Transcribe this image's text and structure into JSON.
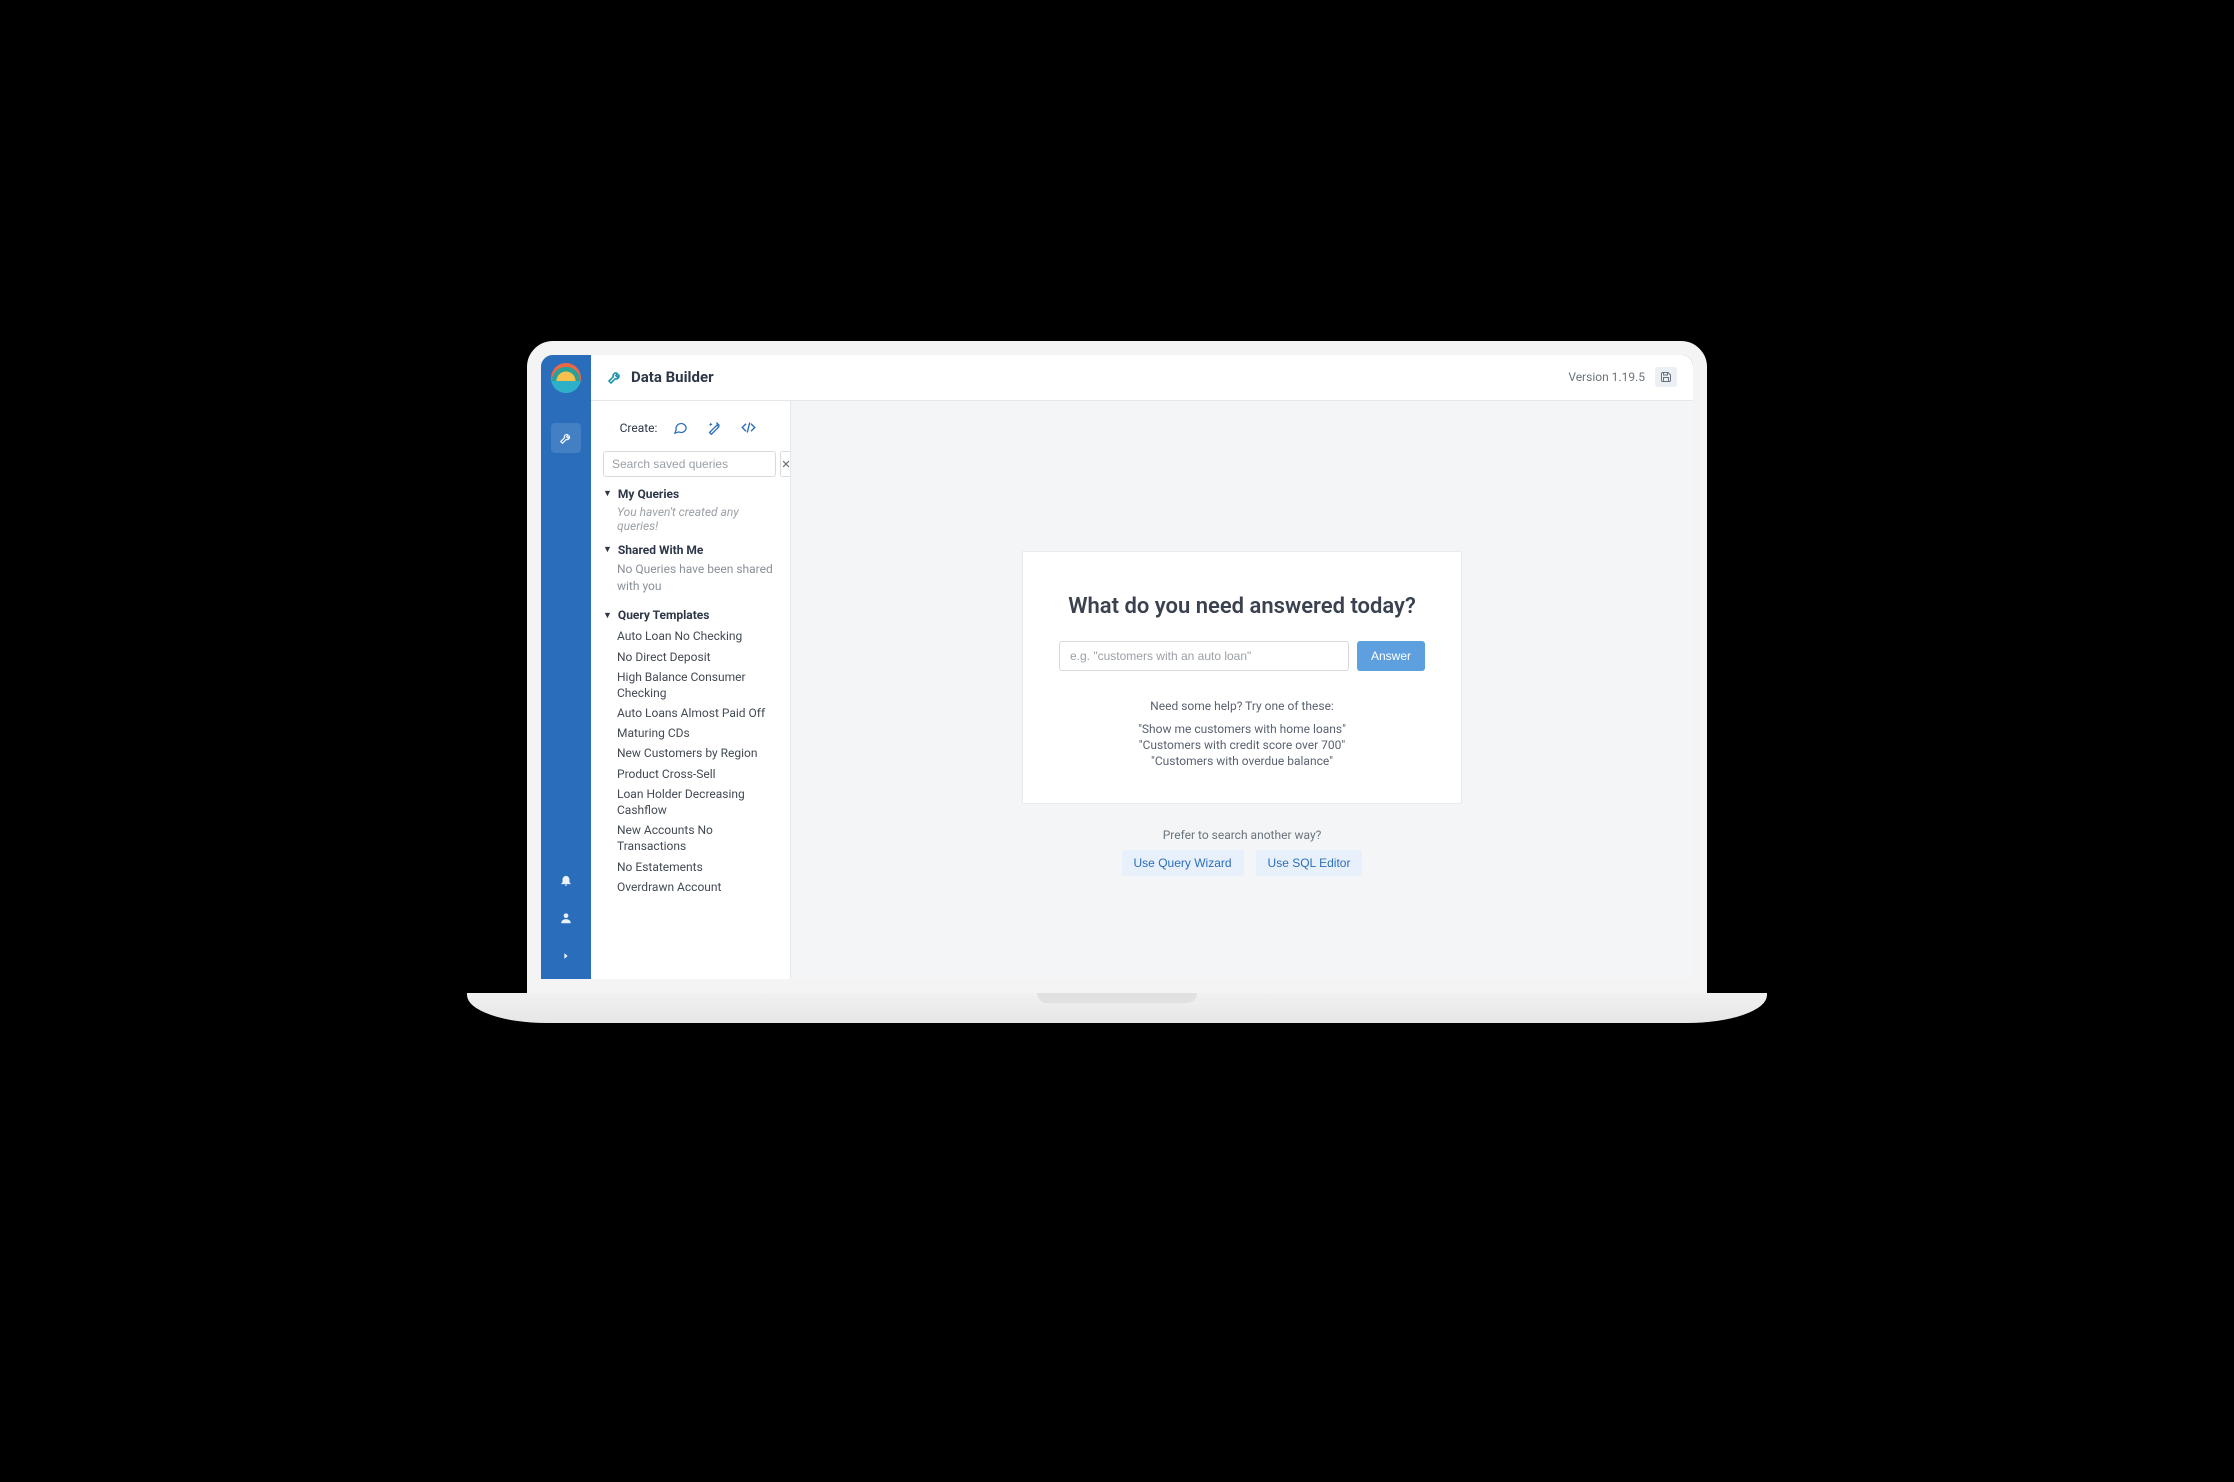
{
  "rail": {
    "icons": {
      "wrench": "wrench",
      "bell": "bell",
      "user": "user",
      "expand": "chevron-right"
    }
  },
  "header": {
    "title": "Data Builder",
    "version_label": "Version 1.19.5"
  },
  "sidepanel": {
    "create_label": "Create:",
    "search_placeholder": "Search saved queries",
    "sections": {
      "my_queries": {
        "title": "My Queries",
        "empty": "You haven't created any queries!"
      },
      "shared": {
        "title": "Shared With Me",
        "empty": "No Queries have been shared with you"
      },
      "templates": {
        "title": "Query Templates",
        "items": [
          "Auto Loan No Checking",
          "No Direct Deposit",
          "High Balance Consumer Checking",
          "Auto Loans Almost Paid Off",
          "Maturing CDs",
          "New Customers by Region",
          "Product Cross-Sell",
          "Loan Holder Decreasing Cashflow",
          "New Accounts No Transactions",
          "No Estatements",
          "Overdrawn Account"
        ]
      }
    }
  },
  "main": {
    "heading": "What do you need answered today?",
    "input_placeholder": "e.g. \"customers with an auto loan\"",
    "answer_label": "Answer",
    "help_head": "Need some help? Try one of these:",
    "examples": [
      "\"Show me customers with home loans\"",
      "\"Customers with credit score over 700\"",
      "\"Customers with overdue balance\""
    ],
    "prefer_label": "Prefer to search another way?",
    "alt_buttons": {
      "wizard": "Use Query Wizard",
      "sql": "Use SQL Editor"
    }
  }
}
